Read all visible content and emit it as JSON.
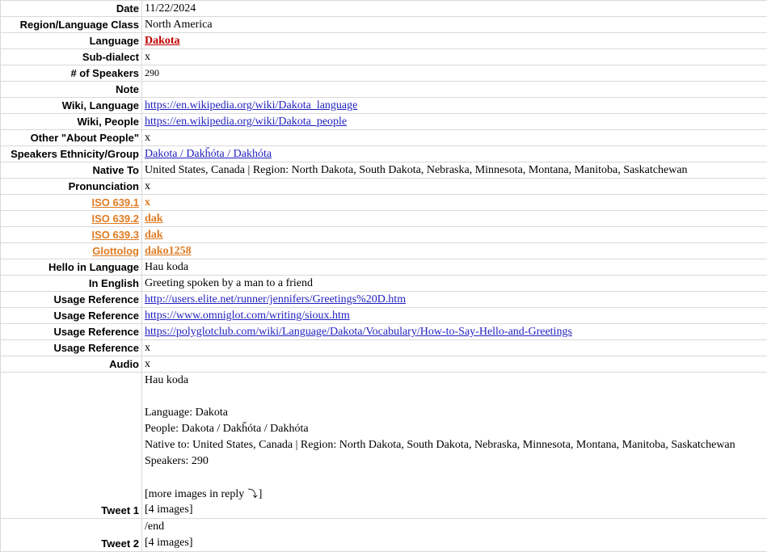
{
  "rows": [
    {
      "label": "Date",
      "value": "11/22/2024"
    },
    {
      "label": "Region/Language Class",
      "value": "North America"
    },
    {
      "label": "Language",
      "value": "Dakota"
    },
    {
      "label": "Sub-dialect",
      "value": "x"
    },
    {
      "label": "# of Speakers",
      "value": "290"
    },
    {
      "label": "Note",
      "value": ""
    },
    {
      "label": "Wiki, Language",
      "value": "https://en.wikipedia.org/wiki/Dakota_language"
    },
    {
      "label": "Wiki, People",
      "value": "https://en.wikipedia.org/wiki/Dakota_people"
    },
    {
      "label": "Other \"About People\"",
      "value": "x"
    },
    {
      "label": "Speakers Ethnicity/Group",
      "value": "Dakota / Dakȟóta / Dakhóta"
    },
    {
      "label": "Native To",
      "value": "United States, Canada | Region: North Dakota, South Dakota, Nebraska, Minnesota, Montana, Manitoba, Saskatchewan"
    },
    {
      "label": "Pronunciation",
      "value": "x"
    },
    {
      "label": "ISO 639.1",
      "value": "x"
    },
    {
      "label": "ISO 639.2",
      "value": "dak"
    },
    {
      "label": "ISO 639.3",
      "value": "dak"
    },
    {
      "label": "Glottolog",
      "value": "dako1258"
    },
    {
      "label": "Hello in Language",
      "value": "Hau koda"
    },
    {
      "label": "In English",
      "value": "Greeting spoken by a man to a friend"
    },
    {
      "label": "Usage Reference",
      "value": "http://users.elite.net/runner/jennifers/Greetings%20D.htm"
    },
    {
      "label": "Usage Reference",
      "value": "https://www.omniglot.com/writing/sioux.htm"
    },
    {
      "label": "Usage Reference",
      "value": "https://polyglotclub.com/wiki/Language/Dakota/Vocabulary/How-to-Say-Hello-and-Greetings"
    },
    {
      "label": "Usage Reference",
      "value": "x"
    },
    {
      "label": "Audio",
      "value": "x"
    }
  ],
  "tweet1": {
    "label": "Tweet 1",
    "lines": [
      "Hau koda",
      "",
      "Language: Dakota",
      "People: Dakota / Dakȟóta / Dakhóta",
      "Native to: United States, Canada | Region: North Dakota, South Dakota, Nebraska, Minnesota, Montana, Manitoba, Saskatchewan",
      "Speakers: 290",
      ""
    ],
    "more_prefix": "[more images in reply ",
    "more_arrow": "⤵",
    "more_suffix": "]",
    "images": "[4 images]"
  },
  "tweet2": {
    "label": "Tweet 2",
    "lines": [
      "/end"
    ],
    "images": "[4 images]"
  }
}
